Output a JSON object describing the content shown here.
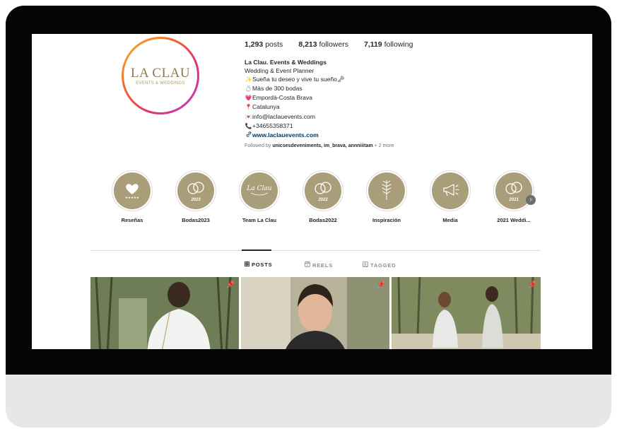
{
  "profile": {
    "logo_text": "LA CLAU",
    "logo_subtext": "EVENTS & WEDDINGS",
    "stats": [
      {
        "value": "1,293",
        "label": "posts"
      },
      {
        "value": "8,213",
        "label": "followers"
      },
      {
        "value": "7,119",
        "label": "following"
      }
    ],
    "name": "La Clau. Events & Weddings",
    "bio_lines": [
      {
        "icon": "sparkle-icon",
        "glyph": "",
        "text": "Wedding & Event Planner"
      },
      {
        "icon": "sparkle-icon",
        "glyph": "✨",
        "text": "Sueña tu deseo y vive tu sueño🗝"
      },
      {
        "icon": "ring-icon",
        "glyph": "💍",
        "text": "Más de 300 bodas"
      },
      {
        "icon": "heart-icon",
        "glyph": "💗",
        "text": "Empordà-Costa Brava"
      },
      {
        "icon": "pin-icon",
        "glyph": "📍",
        "text": "Catalunya"
      },
      {
        "icon": "mail-icon",
        "glyph": "💌",
        "text": "info@laclauevents.com"
      },
      {
        "icon": "phone-icon",
        "glyph": "📞",
        "text": "+34655358371"
      }
    ],
    "website": "www.laclauevents.com",
    "followed_prefix": "Followed by",
    "followed_names": "unicsesdeveniments, im_brava, annniiitam",
    "followed_more": "+ 2 more"
  },
  "highlights": [
    {
      "label": "Reseñas",
      "icon": "heart-stars-icon",
      "year": ""
    },
    {
      "label": "Bodas2023",
      "icon": "rings-icon",
      "year": "2023"
    },
    {
      "label": "Team La Clau",
      "icon": "logo-script-icon",
      "year": ""
    },
    {
      "label": "Bodas2022",
      "icon": "rings-icon",
      "year": "2022"
    },
    {
      "label": "Inspiración",
      "icon": "flower-icon",
      "year": ""
    },
    {
      "label": "Media",
      "icon": "megaphone-icon",
      "year": ""
    },
    {
      "label": "2021 Weddi...",
      "icon": "rings-icon",
      "year": "2021"
    }
  ],
  "tabs": [
    {
      "label": "POSTS",
      "icon": "grid-icon",
      "active": true
    },
    {
      "label": "REELS",
      "icon": "reels-icon",
      "active": false
    },
    {
      "label": "TAGGED",
      "icon": "tagged-icon",
      "active": false
    }
  ],
  "colors": {
    "highlight_bg": "#a99e79",
    "link": "#00376b",
    "text": "#262626"
  }
}
